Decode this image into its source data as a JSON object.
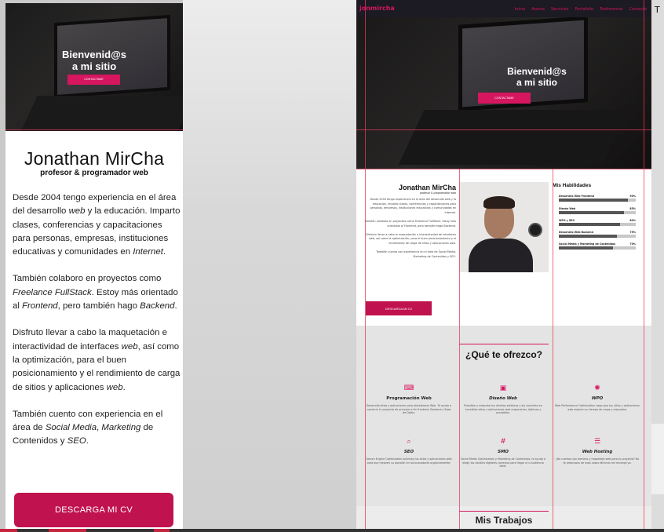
{
  "mobile": {
    "hero_title_line1": "Bienvenid@s",
    "hero_title_line2": "a mi sitio",
    "hero_button": "CONTACTAME",
    "name": "Jonathan MirCha",
    "role": "profesor & programador web",
    "bio": [
      [
        "Desde 2004 tengo experiencia en el área del desarrollo ",
        "web",
        " y la educación. Imparto clases, conferencias y capacitaciones para personas, empresas, instituciones educativas y comunidades en ",
        "Internet",
        "."
      ],
      [
        "También colaboro en proyectos como ",
        "Freelance FullStack",
        ". Estoy más orientado al ",
        "Frontend",
        ", pero también hago ",
        "Backend",
        "."
      ],
      [
        "Disfruto llevar a cabo la maquetación e interactividad de interfaces ",
        "web",
        ", así como la optimización, para el buen posicionamiento y el rendimiento de carga de sitios y aplicaciones ",
        "web",
        "."
      ],
      [
        "También cuento con experiencia en el área de ",
        "Social Media",
        ", ",
        "Marketing",
        " de Contenidos y ",
        "SEO",
        "."
      ]
    ],
    "cv_button": "DESCARGA MI CV"
  },
  "desktop": {
    "logo": "jonmircha",
    "menu": [
      "Inicio",
      "Acerca",
      "Servicios",
      "Portafolio",
      "Testimonios",
      "Contacto"
    ],
    "hero_title_line1": "Bienvenid@s",
    "hero_title_line2": "a mi sitio",
    "hero_button": "CONTACTAME",
    "name": "Jonathan MirCha",
    "role": "profesor & programador web",
    "bio": [
      "Desde 2004 tengo experiencia en el área del desarrollo web y la educación. Imparto clases, conferencias y capacitaciones para personas, empresas, instituciones educativas y comunidades en Internet.",
      "También colaboro en proyectos como Freelance FullStack. Estoy más orientado al Frontend, pero también hago Backend.",
      "Disfruto llevar a cabo la maquetación e interactividad de interfaces web, así como la optimización, para el buen posicionamiento y el rendimiento de carga de sitios y aplicaciones web.",
      "También cuento con experiencia en el área de Social Media, Marketing de Contenidos y SEO."
    ],
    "cv_button": "DESCARGA MI CV",
    "skills_title": "Mis Habilidades",
    "skills": [
      {
        "label": "Desarrollo Web Frontend",
        "value": "90%",
        "fraction": 0.9
      },
      {
        "label": "Diseño Web",
        "value": "85%",
        "fraction": 0.85
      },
      {
        "label": "WPO y SEO",
        "value": "80%",
        "fraction": 0.8
      },
      {
        "label": "Desarrollo Web Backend",
        "value": "75%",
        "fraction": 0.75
      },
      {
        "label": "Social Media y Marketing de Contenidos",
        "value": "70%",
        "fraction": 0.7
      }
    ],
    "offer_title": "¿Qué te ofrezco?",
    "services": [
      {
        "icon": "code-icon",
        "glyph": "⌨",
        "title": "Programación Web",
        "desc": "Desarrollo sitios y aplicaciones para plataformas Web. Te ayudo a construir tu proyecto de principio a fin Frontend, Backend y Base de Datos."
      },
      {
        "icon": "design-icon",
        "glyph": "▣",
        "title": "Diseño Web",
        "desc": "Prototipo y maqueto tus diseños estáticos y los convierto en increíbles sitios y aplicaciones web responsivas, óptimas y accesibles."
      },
      {
        "icon": "speed-icon",
        "glyph": "✺",
        "title": "WPO",
        "desc": "Web Performance Optimization hago que tus sitios y aplicaciones web mejoren su tiempo de carga y respuesta."
      },
      {
        "icon": "search-icon",
        "glyph": "⌕",
        "title": "SEO",
        "desc": "Search Engine Optimization optimizo tus sitios y aplicaciones web para que mejoren su posición en los buscadores orgánicamente."
      },
      {
        "icon": "hashtag-icon",
        "glyph": "#",
        "title": "SMO",
        "desc": "Social Media Optimization y Marketing de Contenidos, te ayudo a elegir los canales digitales correctos para llegar a tu audiencia ideal."
      },
      {
        "icon": "server-icon",
        "glyph": "☰",
        "title": "Web Hosting",
        "desc": "¿No cuentas con dominio y hospedaje web para tu proyecto? No te preocupes de esas cosas técnicas me encargo yo."
      }
    ],
    "works_title": "Mis Trabajos"
  },
  "edge_text": "T",
  "accent_color": "#d6165f"
}
